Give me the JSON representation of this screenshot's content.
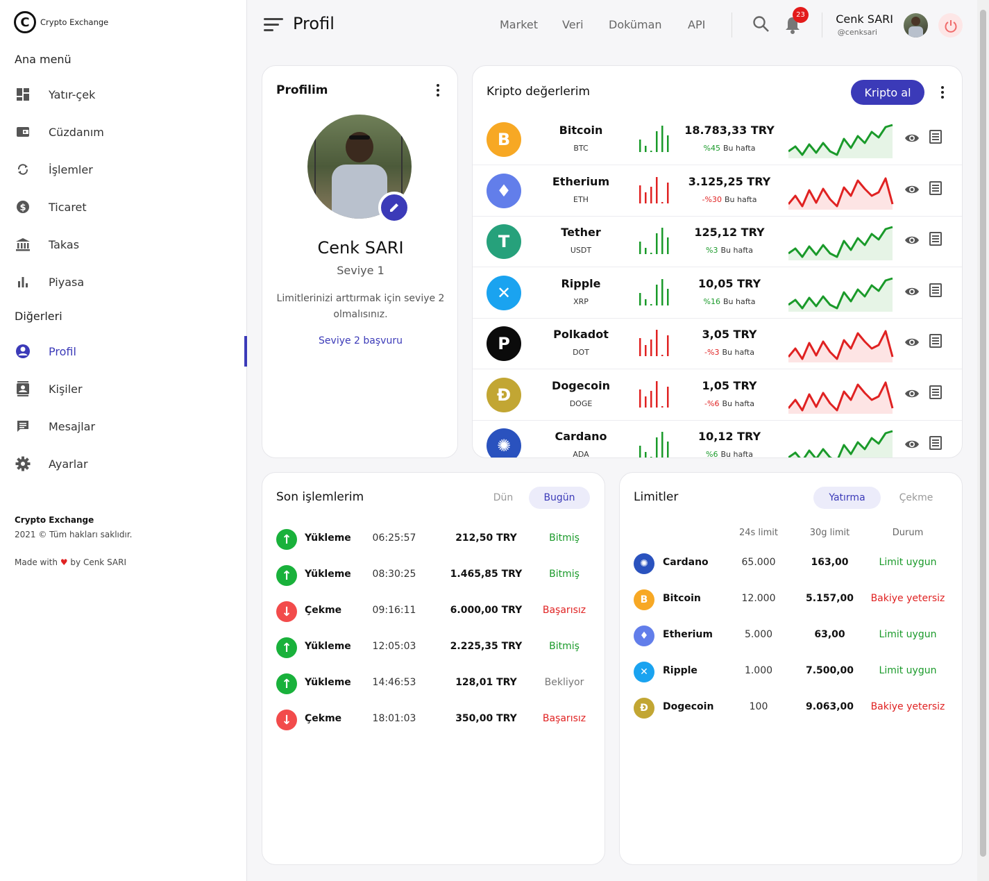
{
  "brand": {
    "logo_letter": "C",
    "name": "Crypto Exchange"
  },
  "sidebar": {
    "main_title": "Ana menü",
    "main_items": [
      {
        "label": "Yatır-çek",
        "icon": "dashboard-icon"
      },
      {
        "label": "Cüzdanım",
        "icon": "wallet-icon"
      },
      {
        "label": "İşlemler",
        "icon": "sync-icon"
      },
      {
        "label": "Ticaret",
        "icon": "dollar-icon"
      },
      {
        "label": "Takas",
        "icon": "bank-icon"
      },
      {
        "label": "Piyasa",
        "icon": "bar-chart-icon"
      }
    ],
    "other_title": "Diğerleri",
    "other_items": [
      {
        "label": "Profil",
        "icon": "account-circle-icon",
        "active": true
      },
      {
        "label": "Kişiler",
        "icon": "contacts-icon"
      },
      {
        "label": "Mesajlar",
        "icon": "message-icon"
      },
      {
        "label": "Ayarlar",
        "icon": "gear-icon"
      }
    ],
    "footer": {
      "brand": "Crypto Exchange",
      "copyright": "2021 © Tüm hakları saklıdır.",
      "made_prefix": "Made with",
      "made_suffix": "by Cenk SARI"
    }
  },
  "header": {
    "title": "Profil",
    "links": [
      "Market",
      "Veri",
      "Doküman",
      "API"
    ],
    "notification_count": "23",
    "user_name": "Cenk SARI",
    "user_handle": "@cenksari"
  },
  "profile_card": {
    "title": "Profilim",
    "name": "Cenk SARI",
    "level": "Seviye 1",
    "description": "Limitlerinizi arttırmak için seviye 2 olmalısınız.",
    "link": "Seviye 2 başvuru"
  },
  "crypto_card": {
    "title": "Kripto değerlerim",
    "buy_button": "Kripto al",
    "rows": [
      {
        "name": "Bitcoin",
        "symbol": "BTC",
        "price": "18.783,33 TRY",
        "change": "%45",
        "period": "Bu hafta",
        "trend": "up",
        "color": "#f7a824",
        "glyph": "B"
      },
      {
        "name": "Etherium",
        "symbol": "ETH",
        "price": "3.125,25 TRY",
        "change": "-%30",
        "period": "Bu hafta",
        "trend": "down",
        "color": "#627eea",
        "glyph": "♦"
      },
      {
        "name": "Tether",
        "symbol": "USDT",
        "price": "125,12 TRY",
        "change": "%3",
        "period": "Bu hafta",
        "trend": "up",
        "color": "#26a17b",
        "glyph": "T"
      },
      {
        "name": "Ripple",
        "symbol": "XRP",
        "price": "10,05 TRY",
        "change": "%16",
        "period": "Bu hafta",
        "trend": "up",
        "color": "#1aa3f0",
        "glyph": "✕"
      },
      {
        "name": "Polkadot",
        "symbol": "DOT",
        "price": "3,05 TRY",
        "change": "-%3",
        "period": "Bu hafta",
        "trend": "down",
        "color": "#0b0b0b",
        "glyph": "P"
      },
      {
        "name": "Dogecoin",
        "symbol": "DOGE",
        "price": "1,05 TRY",
        "change": "-%6",
        "period": "Bu hafta",
        "trend": "down",
        "color": "#c2a633",
        "glyph": "Ð"
      },
      {
        "name": "Cardano",
        "symbol": "ADA",
        "price": "10,12 TRY",
        "change": "%6",
        "period": "Bu hafta",
        "trend": "up",
        "color": "#2a52be",
        "glyph": "✺"
      }
    ]
  },
  "transactions_card": {
    "title": "Son işlemlerim",
    "tabs": [
      "Dün",
      "Bugün"
    ],
    "active_tab": "Bugün",
    "rows": [
      {
        "type": "Yükleme",
        "dir": "up",
        "time": "06:25:57",
        "amount": "212,50 TRY",
        "status": "Bitmiş",
        "status_kind": "ok"
      },
      {
        "type": "Yükleme",
        "dir": "up",
        "time": "08:30:25",
        "amount": "1.465,85 TRY",
        "status": "Bitmiş",
        "status_kind": "ok"
      },
      {
        "type": "Çekme",
        "dir": "down",
        "time": "09:16:11",
        "amount": "6.000,00 TRY",
        "status": "Başarısız",
        "status_kind": "bad"
      },
      {
        "type": "Yükleme",
        "dir": "up",
        "time": "12:05:03",
        "amount": "2.225,35 TRY",
        "status": "Bitmiş",
        "status_kind": "ok"
      },
      {
        "type": "Yükleme",
        "dir": "up",
        "time": "14:46:53",
        "amount": "128,01 TRY",
        "status": "Bekliyor",
        "status_kind": "wait"
      },
      {
        "type": "Çekme",
        "dir": "down",
        "time": "18:01:03",
        "amount": "350,00 TRY",
        "status": "Başarısız",
        "status_kind": "bad"
      }
    ]
  },
  "limits_card": {
    "title": "Limitler",
    "tabs": [
      "Yatırma",
      "Çekme"
    ],
    "active_tab": "Yatırma",
    "columns": [
      "24s limit",
      "30g limit",
      "Durum"
    ],
    "rows": [
      {
        "name": "Cardano",
        "limit24": "65.000",
        "limit30": "163,00",
        "status": "Limit uygun",
        "kind": "ok",
        "color": "#2a52be",
        "glyph": "✺"
      },
      {
        "name": "Bitcoin",
        "limit24": "12.000",
        "limit30": "5.157,00",
        "status": "Bakiye yetersiz",
        "kind": "bad",
        "color": "#f7a824",
        "glyph": "B"
      },
      {
        "name": "Etherium",
        "limit24": "5.000",
        "limit30": "63,00",
        "status": "Limit uygun",
        "kind": "ok",
        "color": "#627eea",
        "glyph": "♦"
      },
      {
        "name": "Ripple",
        "limit24": "1.000",
        "limit30": "7.500,00",
        "status": "Limit uygun",
        "kind": "ok",
        "color": "#1aa3f0",
        "glyph": "✕"
      },
      {
        "name": "Dogecoin",
        "limit24": "100",
        "limit30": "9.063,00",
        "status": "Bakiye yetersiz",
        "kind": "bad",
        "color": "#c2a633",
        "glyph": "Ð"
      }
    ]
  },
  "colors": {
    "accent": "#3b3ab8",
    "up": "#1a9a2a",
    "down": "#e02222"
  }
}
